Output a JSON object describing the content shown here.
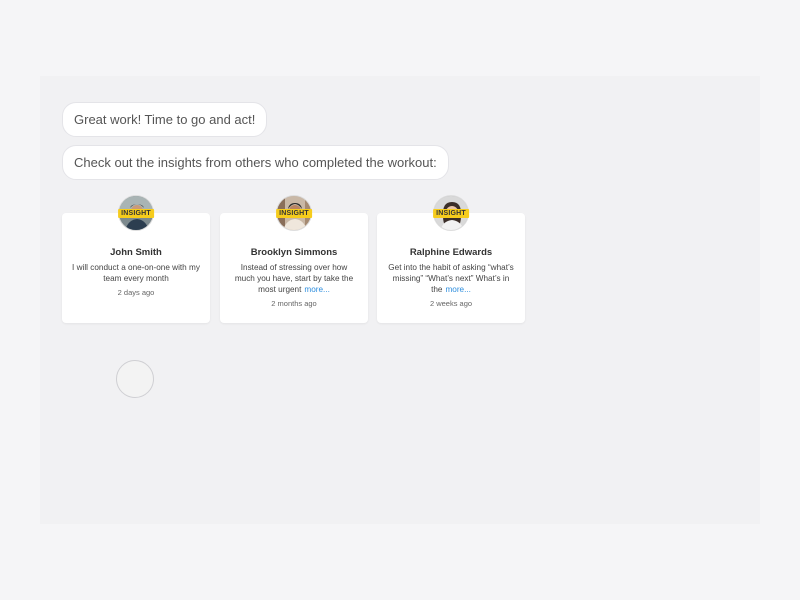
{
  "chat": {
    "message_1": "Great work! Time to go and act!",
    "message_2": "Check out the insights from others who completed the workout:"
  },
  "cards": [
    {
      "badge": "INSIGHT",
      "name": "John Smith",
      "text": "I will conduct a one-on-one with my team every month",
      "more": "",
      "time": "2 days ago"
    },
    {
      "badge": "INSIGHT",
      "name": "Brooklyn Simmons",
      "text": "Instead of stressing over how much you have, start by take the most urgent",
      "more": "more...",
      "time": "2 months ago"
    },
    {
      "badge": "INSIGHT",
      "name": "Ralphine Edwards",
      "text": "Get into the habit of asking “what’s missing” “What’s next” What’s in the",
      "more": "more...",
      "time": "2 weeks ago"
    }
  ],
  "colors": {
    "badge": "#f6cc1c",
    "link": "#2e8ede",
    "panel": "#f1f1f3"
  }
}
